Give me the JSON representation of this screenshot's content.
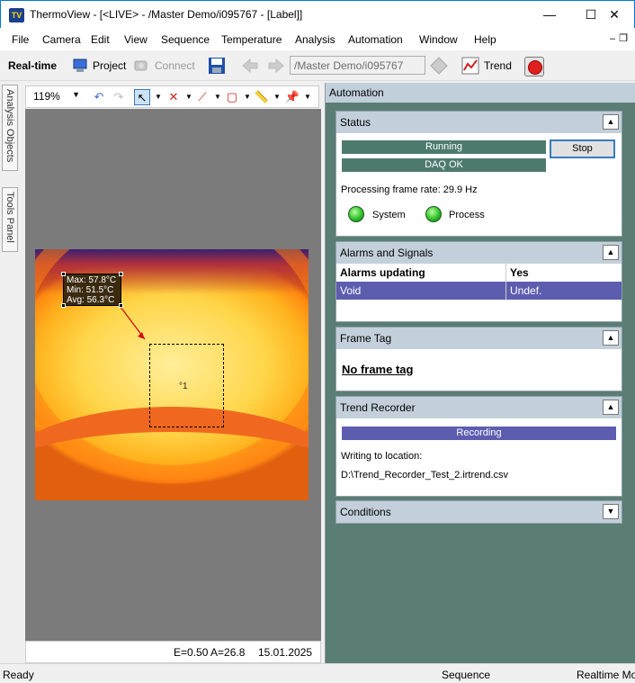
{
  "window": {
    "title": "ThermoView - [<LIVE> - /Master Demo/i095767 - [Label]]",
    "icon_text": "TV",
    "minimize": "—",
    "maximize": "☐",
    "close": "✕"
  },
  "menu": [
    "File",
    "Camera",
    "Edit",
    "View",
    "Sequence",
    "Temperature",
    "Analysis",
    "Automation",
    "Window",
    "Help"
  ],
  "toolbar": {
    "realtime_label": "Real-time",
    "project_label": "Project",
    "connect_label": "Connect",
    "path_value": "/Master Demo/i095767",
    "trend_label": "Trend"
  },
  "side_tabs": [
    "Analysis Objects",
    "Tools Panel"
  ],
  "image_toolbar": {
    "zoom": "119%"
  },
  "image": {
    "label_lines": [
      "Max: 57.8°C",
      "Min: 51.5°C",
      "Avg: 56.3°C"
    ],
    "roi_label": "°1",
    "status_emission": "E=0.50 A=26.8",
    "status_date": "15.01.2025"
  },
  "automation": {
    "header": "Automation",
    "status": {
      "title": "Status",
      "running": "Running",
      "daq": "DAQ OK",
      "stop": "Stop",
      "frame_rate": "Processing frame rate: 29.9 Hz",
      "system": "System",
      "process": "Process"
    },
    "alarms": {
      "title": "Alarms and Signals",
      "rows": [
        {
          "name": "Alarms updating",
          "value": "Yes"
        },
        {
          "name": "Void",
          "value": "Undef."
        }
      ]
    },
    "frame_tag": {
      "title": "Frame Tag",
      "text": "No frame tag"
    },
    "trend_recorder": {
      "title": "Trend Recorder",
      "recording": "Recording",
      "writing": "Writing to location:",
      "path": "D:\\Trend_Recorder_Test_2.irtrend.csv"
    },
    "conditions": {
      "title": "Conditions"
    }
  },
  "statusbar": {
    "ready": "Ready",
    "sequence": "Sequence",
    "realtime": "Realtime Mo"
  },
  "colors": {
    "panel_bg": "#5a7d74",
    "bar_green": "#4d7a6f",
    "selected_row": "#5d5db0",
    "recording": "#5d5db0"
  }
}
